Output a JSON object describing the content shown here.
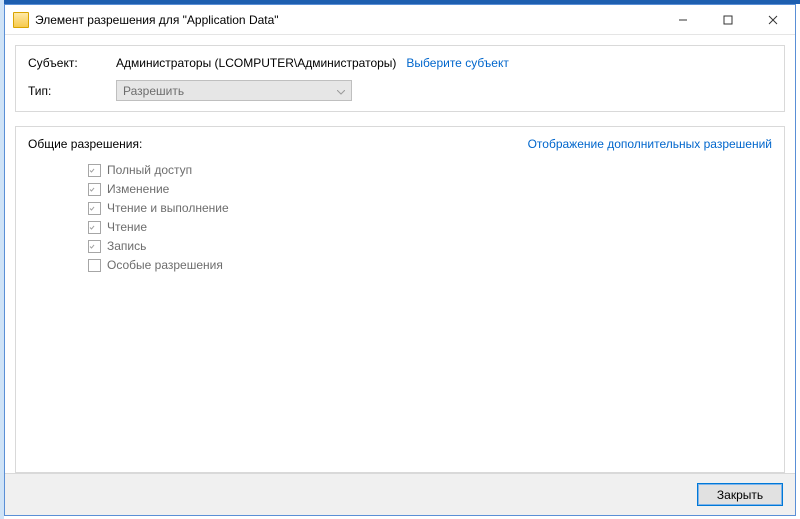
{
  "window": {
    "title": "Элемент разрешения для \"Application Data\""
  },
  "subject": {
    "label": "Субъект:",
    "principal": "Администраторы (LCOMPUTER\\Администраторы)",
    "select_link": "Выберите субъект"
  },
  "type": {
    "label": "Тип:",
    "value": "Разрешить"
  },
  "permissions": {
    "section_title": "Общие разрешения:",
    "advanced_link": "Отображение дополнительных разрешений",
    "items": [
      {
        "label": "Полный доступ",
        "checked": true
      },
      {
        "label": "Изменение",
        "checked": true
      },
      {
        "label": "Чтение и выполнение",
        "checked": true
      },
      {
        "label": "Чтение",
        "checked": true
      },
      {
        "label": "Запись",
        "checked": true
      },
      {
        "label": "Особые разрешения",
        "checked": false
      }
    ]
  },
  "footer": {
    "close_label": "Закрыть"
  }
}
